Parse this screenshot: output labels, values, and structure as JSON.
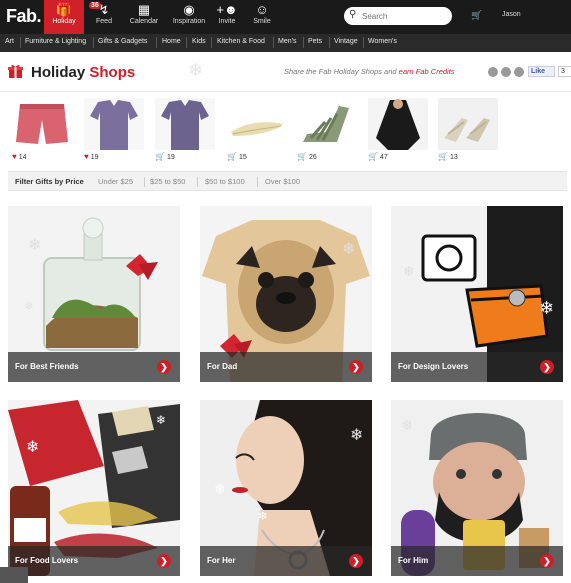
{
  "topnav": {
    "logo": "Fab.",
    "notification_count": "36",
    "items": [
      {
        "label": "Holiday",
        "icon": "gift-icon",
        "active": true
      },
      {
        "label": "Feed",
        "icon": "feed-icon"
      },
      {
        "label": "Calendar",
        "icon": "calendar-icon"
      },
      {
        "label": "Inspiration",
        "icon": "inspiration-icon"
      },
      {
        "label": "Invite",
        "icon": "invite-icon"
      },
      {
        "label": "Smile",
        "icon": "smile-icon"
      }
    ],
    "search_placeholder": "Search",
    "user_name": "Jason"
  },
  "categories": [
    "Art",
    "Furniture & Lighting",
    "Gifts & Gadgets",
    "Home",
    "Kids",
    "Kitchen & Food",
    "Men's",
    "Pets",
    "Vintage",
    "Women's"
  ],
  "holiday": {
    "title_main": "Holiday",
    "title_accent": "Shops",
    "share_text": "Share the Fab Holiday Shops and",
    "share_credits": "earn Fab Credits",
    "like_label": "Like",
    "like_count": "3"
  },
  "products": [
    {
      "count": "14",
      "icon": "heart-icon"
    },
    {
      "count": "19",
      "icon": "heart-icon"
    },
    {
      "count": "19",
      "icon": "cart-icon"
    },
    {
      "count": "15",
      "icon": "cart-icon"
    },
    {
      "count": "26",
      "icon": "cart-icon"
    },
    {
      "count": "47",
      "icon": "cart-icon"
    },
    {
      "count": "13",
      "icon": "cart-icon"
    }
  ],
  "filter": {
    "title": "Filter Gifts by Price",
    "options": [
      "Under $25",
      "$25 to $50",
      "$50 to $100",
      "Over $100"
    ]
  },
  "tiles": [
    {
      "label": "For Best Friends"
    },
    {
      "label": "For Dad"
    },
    {
      "label": "For Design Lovers"
    },
    {
      "label": "For Food Lovers"
    },
    {
      "label": "For Her"
    },
    {
      "label": "For Him"
    }
  ],
  "colors": {
    "accent": "#cc2028",
    "topbar": "#1a1a1a",
    "catbar": "#2a2a2a"
  }
}
